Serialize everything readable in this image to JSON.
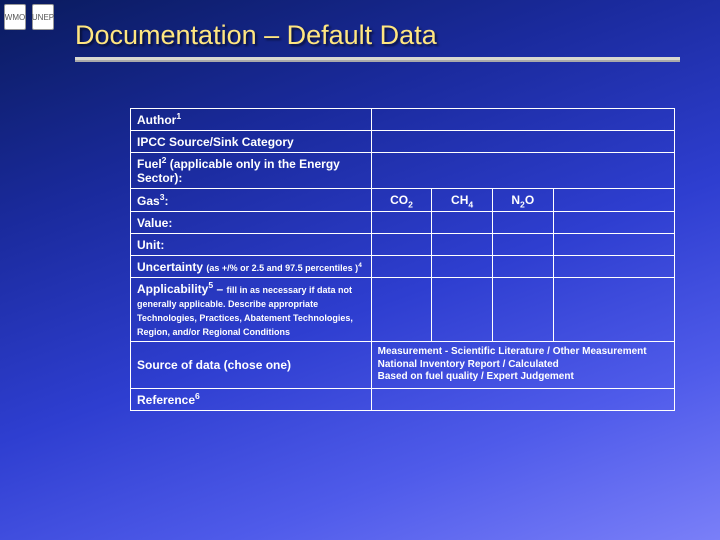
{
  "logos": {
    "left": "WMO",
    "right": "UNEP"
  },
  "title": "Documentation – Default Data",
  "rows": {
    "author": {
      "label_html": "Author<sup>1</sup>"
    },
    "category": {
      "label_html": "IPCC Source/Sink Category"
    },
    "fuel": {
      "label_html": "Fuel<sup>2</sup> (applicable only in the Energy Sector):"
    },
    "gas": {
      "label_html": "Gas<sup>3</sup>:",
      "c1_html": "CO<sub>2</sub>",
      "c2_html": "CH<sub>4</sub>",
      "c3_html": "N<sub>2</sub>O"
    },
    "value": {
      "label_html": "Value:"
    },
    "unit": {
      "label_html": "Unit:"
    },
    "uncertainty": {
      "label_html": "Uncertainty <span class=\"sub\">(as +/% or 2.5 and 97.5 percentiles )<sup>4</sup></span>"
    },
    "applicability": {
      "label_html": "Applicability<sup>5</sup> – <span class=\"sub\">fill in as necessary if data not generally applicable. Describe appropriate Technologies, Practices, Abatement Technologies, Region, and/or Regional Conditions</span>"
    },
    "source": {
      "label_html": "Source of data (chose one)",
      "value_html": "Measurement - Scientific Literature / Other Measurement<br>National Inventory Report / Calculated<br>Based on fuel quality / Expert Judgement"
    },
    "reference": {
      "label_html": "Reference<sup>6</sup>"
    }
  }
}
